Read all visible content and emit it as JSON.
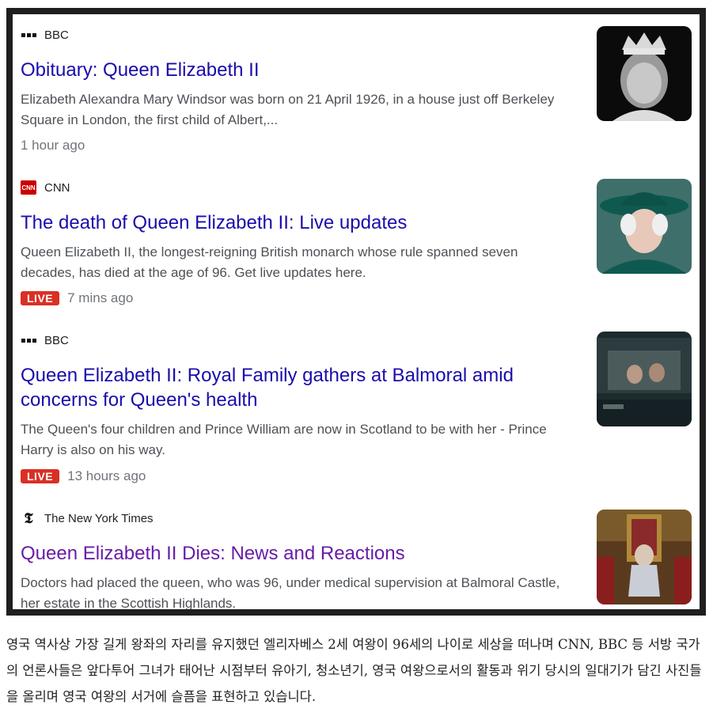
{
  "results": [
    {
      "source": "BBC",
      "title": "Obituary: Queen Elizabeth II",
      "snippet": "Elizabeth Alexandra Mary Windsor was born on 21 April 1926, in a house just off Berkeley Square in London, the first child of Albert,...",
      "time": "1 hour ago"
    },
    {
      "source": "CNN",
      "title": "The death of Queen Elizabeth II: Live updates",
      "snippet": "Queen Elizabeth II, the longest-reigning British monarch whose rule spanned seven decades, has died at the age of 96. Get live updates here.",
      "badge": "LIVE",
      "time": "7 mins ago"
    },
    {
      "source": "BBC",
      "title": "Queen Elizabeth II: Royal Family gathers at Balmoral amid concerns for Queen's health",
      "snippet": "The Queen's four children and Prince William are now in Scotland to be with her - Prince Harry is also on his way.",
      "badge": "LIVE",
      "time": "13 hours ago"
    },
    {
      "source": "The New York Times",
      "title": "Queen Elizabeth II Dies: News and Reactions",
      "snippet": "Doctors had placed the queen, who was 96, under medical supervision at Balmoral Castle, her estate in the Scottish Highlands."
    }
  ],
  "cnn_icon_text": "CNN",
  "nyt_icon_glyph": "𝕿",
  "caption": "영국 역사상 가장 길게 왕좌의 자리를 유지했던 엘리자베스 2세 여왕이 96세의 나이로 세상을 떠나며 CNN, BBC 등 서방 국가의 언론사들은 앞다투어 그녀가 태어난 시점부터 유아기, 청소년기, 영국 여왕으로서의 활동과 위기 당시의 일대기가 담긴 사진들을 올리며 영국 여왕의 서거에 슬픔을 표현하고 있습니다.",
  "colors": {
    "link": "#1a0dab",
    "visited": "#681da8",
    "live": "#d93025"
  }
}
